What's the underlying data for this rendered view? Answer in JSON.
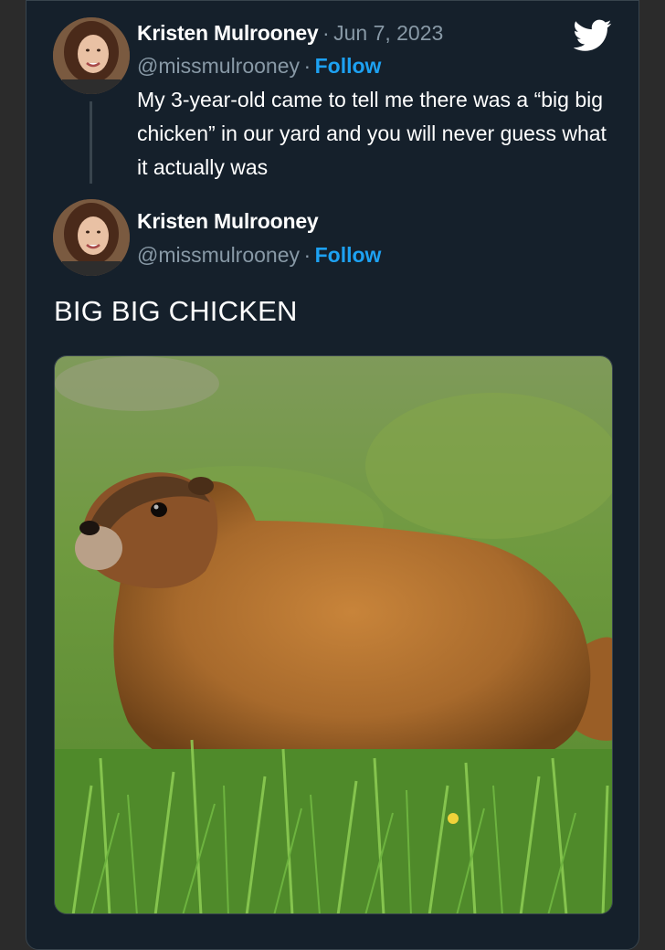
{
  "tweet": {
    "author_name": "Kristen Mulrooney",
    "separator": "·",
    "date": "Jun 7, 2023",
    "handle": "@missmulrooney",
    "follow_label": "Follow",
    "text": "My 3-year-old came to tell me there was a “big big chicken” in our yard and you will never guess what it actually was"
  },
  "reply": {
    "author_name": "Kristen Mulrooney",
    "separator": "·",
    "handle": "@missmulrooney",
    "follow_label": "Follow",
    "text": "BIG BIG CHICKEN"
  },
  "icons": {
    "brand": "twitter-bird-icon"
  },
  "colors": {
    "background": "#15202b",
    "accent": "#1da1f2",
    "secondary_text": "#8899a6",
    "border": "#38444d"
  }
}
